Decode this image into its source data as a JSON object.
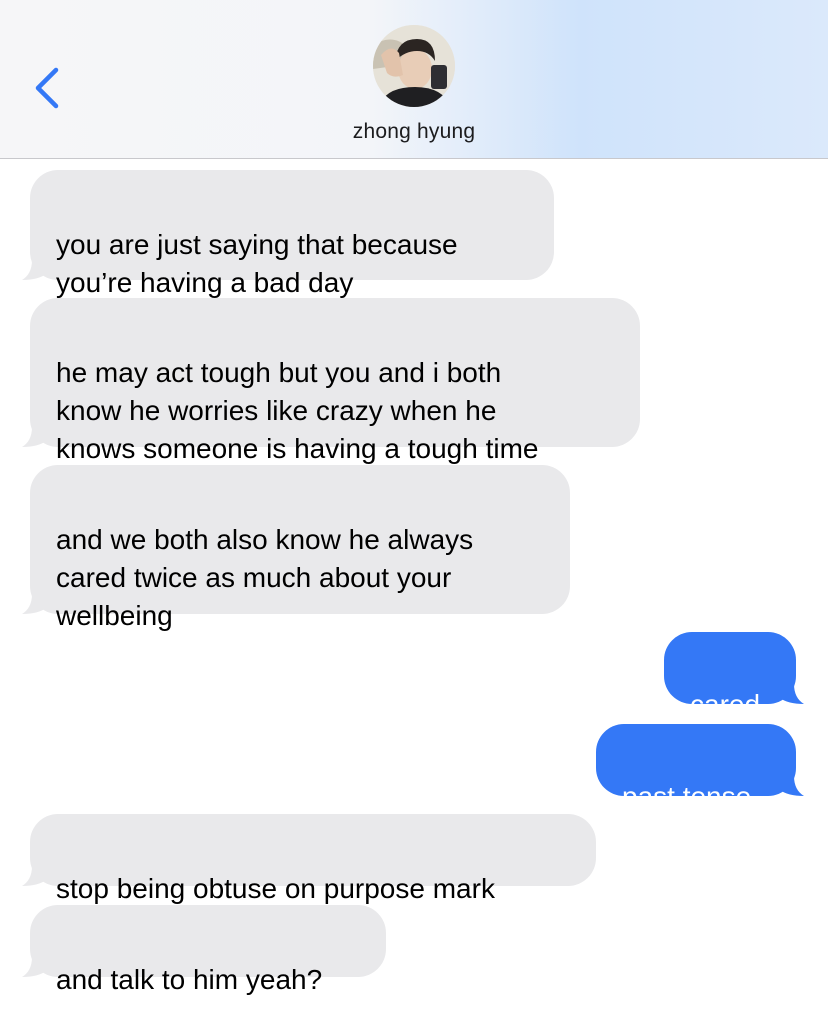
{
  "contact": {
    "name": "zhong hyung"
  },
  "colors": {
    "incoming_bubble": "#e9e9eb",
    "outgoing_bubble": "#3478f6",
    "accent": "#3478f6"
  },
  "icons": {
    "back": "chevron-left-icon"
  },
  "messages": [
    {
      "direction": "incoming",
      "text": "you are just saying that because\nyou’re having a bad day"
    },
    {
      "direction": "incoming",
      "text": "he may act tough but you and i both\nknow he worries like crazy when he\nknows someone is having a tough time"
    },
    {
      "direction": "incoming",
      "text": "and we both also know he always\ncared twice as much about your\nwellbeing"
    },
    {
      "direction": "outgoing",
      "text": "cared"
    },
    {
      "direction": "outgoing",
      "text": "past tense"
    },
    {
      "direction": "incoming",
      "text": "stop being obtuse on purpose mark"
    },
    {
      "direction": "incoming",
      "text": "and talk to him yeah?"
    }
  ]
}
